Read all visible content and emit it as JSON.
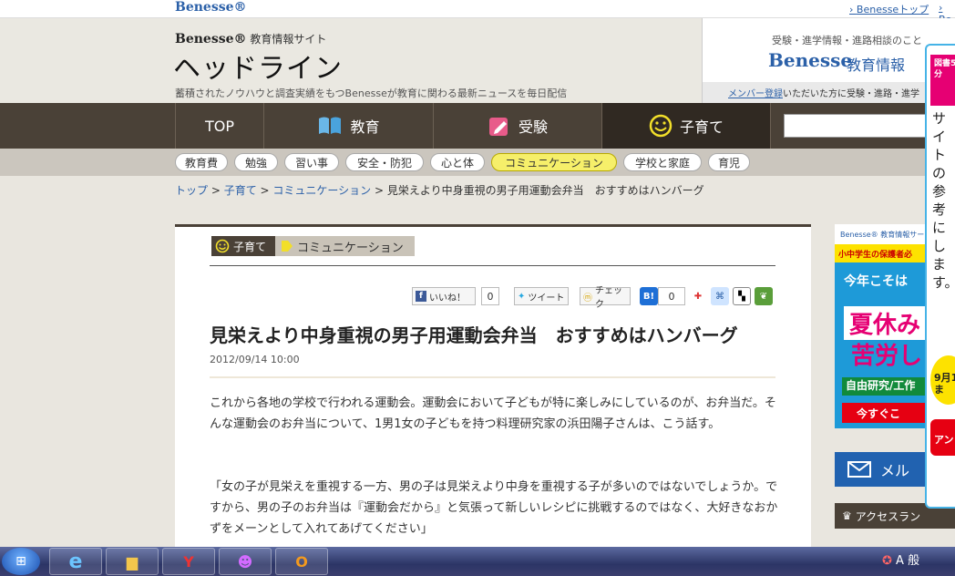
{
  "top": {
    "logo": "Benesse®",
    "link1": "Benesseトップ",
    "link2": "Be"
  },
  "header": {
    "brand": "Benesse®",
    "brand_sub": "教育情報サイト",
    "title": "ヘッドライン",
    "tagline": "蓄積されたノウハウと調査実績をもつBenesseが教育に関わる最新ニュースを毎日配信"
  },
  "side_header": {
    "line1": "受験・進学情報・進路相談のこと",
    "brand": "Benesse",
    "sub": "教育情報",
    "member_link": "メンバー登録",
    "member_text": "いただいた方に受験・進路・進学"
  },
  "nav": {
    "items": [
      {
        "label": "TOP",
        "icon": ""
      },
      {
        "label": "教育",
        "icon": "book-icon"
      },
      {
        "label": "受験",
        "icon": "pencil-icon"
      },
      {
        "label": "子育て",
        "icon": "smiley-icon"
      }
    ],
    "search_placeholder": ""
  },
  "subnav": {
    "items": [
      "教育費",
      "勉強",
      "習い事",
      "安全・防犯",
      "心と体",
      "コミュニケーション",
      "学校と家庭",
      "育児"
    ]
  },
  "breadcrumb": {
    "home": "トップ",
    "sep": " > ",
    "c1": "子育て",
    "c2": "コミュニケーション",
    "current": "見栄えより中身重視の男子用運動会弁当　おすすめはハンバーグ"
  },
  "article": {
    "cat_main": "子育て",
    "cat_sub": "コミュニケーション",
    "social": {
      "like": "いいね！",
      "like_count": "0",
      "tweet": "ツイート",
      "check": "チェック",
      "hatena_count": "0"
    },
    "title": "見栄えより中身重視の男子用運動会弁当　おすすめはハンバーグ",
    "date": "2012/09/14 10:00",
    "para1": "これから各地の学校で行われる運動会。運動会において子どもが特に楽しみにしているのが、お弁当だ。そんな運動会のお弁当について、1男1女の子どもを持つ料理研究家の浜田陽子さんは、こう話す。",
    "para2": "「女の子が見栄えを重視する一方、男の子は見栄えより中身を重視する子が多いのではないでしょうか。ですから、男の子のお弁当は『運動会だから』と気張って新しいレシピに挑戦するのではなく、大好きなおかずをメーンとして入れてあげてください」"
  },
  "sidebar": {
    "ad": {
      "brand": "Benesse® 教育情報サー",
      "line": "小中学生の保護者必",
      "l1": "今年こそは",
      "l2": "夏休み",
      "l3": "苦労し",
      "l4": "自由研究/工作",
      "l5": "今すぐこ"
    },
    "mail": "メル",
    "ranking": "アクセスラン"
  },
  "floating": {
    "badge": "図書5円分",
    "text": "サイトの参考にします。",
    "circle": "9月1ま",
    "button": "アン"
  },
  "taskbar": {
    "tray_text": "A 般"
  },
  "colors": {
    "brand_blue": "#2b60a8",
    "nav_brown": "#4a4137",
    "accent_yellow": "#f6ef6a"
  }
}
